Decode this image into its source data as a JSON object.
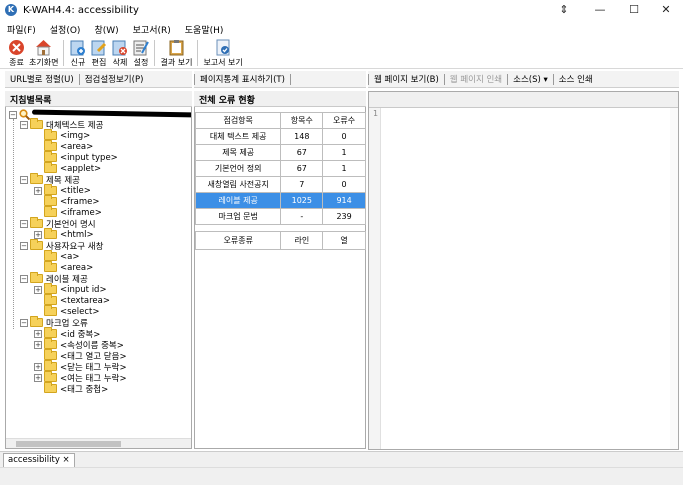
{
  "window": {
    "title": "K-WAH4.4: accessibility",
    "icon_letter": "K",
    "controls": {
      "restore": "⇕",
      "minimize": "—",
      "maximize": "☐",
      "close": "✕"
    }
  },
  "menu": [
    "파일(F)",
    "설정(O)",
    "창(W)",
    "보고서(R)",
    "도움말(H)"
  ],
  "toolbar": {
    "exit": "종료",
    "home": "초기화면",
    "new": "신규",
    "edit": "편집",
    "delete": "삭제",
    "settings": "설정",
    "result": "결과 보기",
    "report": "보고서 보기"
  },
  "toplinks": {
    "url_sort": "URL별로 정렬(U)",
    "check_view": "점검설정보기(P)",
    "page_stats": "페이지통계 표시하기(T)",
    "web_view": "웹 페이지 보기(B)",
    "web_print": "웹 페이지 인쇄",
    "source": "소스(S) ▾",
    "source_print": "소스 인쇄"
  },
  "left": {
    "header": "지침별목록",
    "tree": [
      {
        "label": "대체텍스트 제공",
        "level": 1,
        "pm": "−"
      },
      {
        "label": "<img>",
        "level": 2,
        "pm": ""
      },
      {
        "label": "<area>",
        "level": 2,
        "pm": ""
      },
      {
        "label": "<input type>",
        "level": 2,
        "pm": ""
      },
      {
        "label": "<applet>",
        "level": 2,
        "pm": ""
      },
      {
        "label": "제목 제공",
        "level": 1,
        "pm": "−"
      },
      {
        "label": "<title>",
        "level": 2,
        "pm": "+"
      },
      {
        "label": "<frame>",
        "level": 2,
        "pm": ""
      },
      {
        "label": "<iframe>",
        "level": 2,
        "pm": ""
      },
      {
        "label": "기본언어 명시",
        "level": 1,
        "pm": "−"
      },
      {
        "label": "<html>",
        "level": 2,
        "pm": "+"
      },
      {
        "label": "사용자요구 새창",
        "level": 1,
        "pm": "−"
      },
      {
        "label": "<a>",
        "level": 2,
        "pm": ""
      },
      {
        "label": "<area>",
        "level": 2,
        "pm": ""
      },
      {
        "label": "레이블 제공",
        "level": 1,
        "pm": "−"
      },
      {
        "label": "<input id>",
        "level": 2,
        "pm": "+"
      },
      {
        "label": "<textarea>",
        "level": 2,
        "pm": ""
      },
      {
        "label": "<select>",
        "level": 2,
        "pm": ""
      },
      {
        "label": "마크업 오류",
        "level": 1,
        "pm": "−"
      },
      {
        "label": "<id 중복>",
        "level": 2,
        "pm": "+"
      },
      {
        "label": "<속성이름 중복>",
        "level": 2,
        "pm": "+"
      },
      {
        "label": "<태그 열고 닫음>",
        "level": 2,
        "pm": ""
      },
      {
        "label": "<닫는 태그 누락>",
        "level": 2,
        "pm": "+"
      },
      {
        "label": "<여는 태그 누락>",
        "level": 2,
        "pm": "+"
      },
      {
        "label": "<태그 중첩>",
        "level": 2,
        "pm": ""
      }
    ]
  },
  "middle": {
    "header": "전체 오류 현황",
    "columns": [
      "점검항목",
      "항목수",
      "오류수"
    ],
    "rows": [
      [
        "대체 텍스트 제공",
        "148",
        "0"
      ],
      [
        "제목 제공",
        "67",
        "1"
      ],
      [
        "기본언어 정의",
        "67",
        "1"
      ],
      [
        "새창열림 사전공지",
        "7",
        "0"
      ],
      [
        "레이블 제공",
        "1025",
        "914"
      ],
      [
        "마크업 문법",
        "-",
        "239"
      ]
    ],
    "selected_row": 4,
    "type_columns": [
      "오류종류",
      "라인",
      "열"
    ]
  },
  "right": {
    "line_number": "1"
  },
  "bottom_tab": "accessibility ×"
}
